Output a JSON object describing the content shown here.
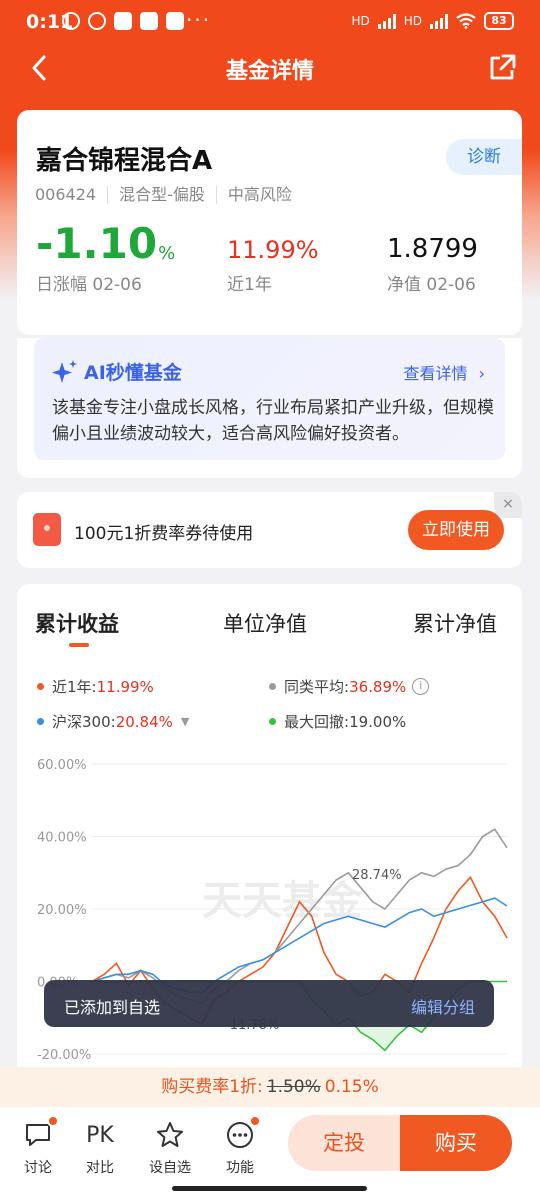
{
  "status_bar": {
    "time": "0:11",
    "dots": "···",
    "battery": "83",
    "net1": "HD",
    "net2": "HD"
  },
  "nav": {
    "title": "基金详情"
  },
  "fund": {
    "name": "嘉合锦程混合A",
    "code": "006424",
    "type": "混合型-偏股",
    "risk": "中高风险",
    "diagnose_label": "诊断",
    "daily_change": "-1.10",
    "daily_change_unit": "%",
    "daily_change_label": "日涨幅 02-06",
    "year_return": "11.99%",
    "year_return_label": "近1年",
    "nav_value": "1.8799",
    "nav_label": "净值 02-06"
  },
  "ai": {
    "title": "AI秒懂基金",
    "more": "查看详情",
    "text": "该基金专注小盘成长风格，行业布局紧扣产业升级，但规模偏小且业绩波动较大，适合高风险偏好投资者。"
  },
  "coupon": {
    "text": "100元1折费率券待使用",
    "button": "立即使用",
    "close": "×"
  },
  "chart_tabs": {
    "cumulative": "累计收益",
    "unit_nav": "单位净值",
    "acc_nav": "累计净值"
  },
  "legend": {
    "year_label": "近1年:",
    "year_value": "11.99%",
    "peer_label": "同类平均:",
    "peer_value": "36.89%",
    "csi_label": "沪深300:",
    "csi_value": "20.84%",
    "drawdown_label": "最大回撤:",
    "drawdown_value": "19.00%"
  },
  "chart_data": {
    "type": "line",
    "yticks": [
      "60.00%",
      "40.00%",
      "20.00%",
      "0.00%",
      "-20.00%"
    ],
    "ylim": [
      -20,
      60
    ],
    "x_range": [
      "2025-02-06",
      "2026-02-06"
    ],
    "watermark": "天天基金",
    "annotations": [
      "28.74%",
      "-11.78%"
    ],
    "colors": {
      "fund": "#f05a22",
      "peer": "#9b9b9b",
      "csi300": "#3a8fe0",
      "drawdown": "#37c23c"
    },
    "series": [
      {
        "name": "近1年",
        "values": [
          0,
          2,
          5,
          -1,
          3,
          -2,
          -6,
          -8,
          -10,
          -11.78,
          -5,
          -3,
          0,
          2,
          4,
          8,
          15,
          22,
          18,
          8,
          2,
          0,
          -4,
          -3,
          2,
          0,
          -3,
          5,
          12,
          20,
          25,
          28.74,
          22,
          18,
          11.99
        ]
      },
      {
        "name": "同类平均",
        "values": [
          0,
          1,
          2,
          1,
          3,
          1,
          -2,
          -4,
          -5,
          -6,
          -2,
          0,
          3,
          5,
          6,
          8,
          12,
          16,
          20,
          24,
          28,
          30,
          26,
          22,
          20,
          24,
          28,
          30,
          29,
          31,
          32,
          35,
          40,
          42,
          36.89
        ]
      },
      {
        "name": "沪深300",
        "values": [
          0,
          1,
          2,
          2,
          3,
          2,
          -1,
          -2,
          -3,
          -3,
          0,
          2,
          4,
          5,
          6,
          8,
          10,
          12,
          14,
          16,
          17,
          18,
          17,
          16,
          15,
          17,
          19,
          20,
          18,
          19,
          20,
          21,
          22,
          23,
          20.84
        ]
      },
      {
        "name": "最大回撤",
        "values": [
          0,
          0,
          0,
          0,
          0,
          0,
          0,
          0,
          0,
          0,
          0,
          0,
          0,
          0,
          0,
          0,
          0,
          0,
          -5,
          -8,
          -12,
          -10,
          -14,
          -16,
          -19,
          -15,
          -12,
          -14,
          -10,
          -6,
          -2,
          0,
          0,
          0,
          0
        ]
      }
    ],
    "shown_yticks": 5
  },
  "toast": {
    "message": "已添加到自选",
    "action": "编辑分组"
  },
  "fee": {
    "label": "购买费率1折:",
    "old": "1.50%",
    "new": "0.15%"
  },
  "bottom": {
    "discuss": "讨论",
    "pk_glyph": "PK",
    "compare": "对比",
    "watch": "设自选",
    "function": "功能",
    "sip": "定投",
    "buy": "购买"
  }
}
